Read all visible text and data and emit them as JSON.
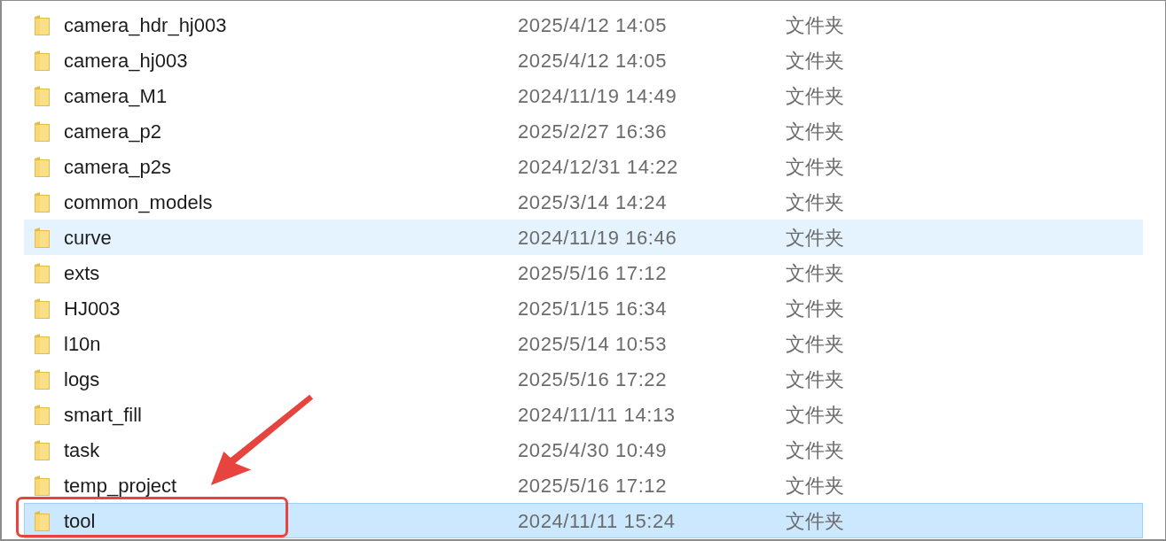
{
  "files": [
    {
      "name": "camera_hdr_hj003",
      "modified": "2025/4/12 14:05",
      "type": "文件夹",
      "selected": false,
      "hovered": false,
      "annotated": false
    },
    {
      "name": "camera_hj003",
      "modified": "2025/4/12 14:05",
      "type": "文件夹",
      "selected": false,
      "hovered": false,
      "annotated": false
    },
    {
      "name": "camera_M1",
      "modified": "2024/11/19 14:49",
      "type": "文件夹",
      "selected": false,
      "hovered": false,
      "annotated": false
    },
    {
      "name": "camera_p2",
      "modified": "2025/2/27 16:36",
      "type": "文件夹",
      "selected": false,
      "hovered": false,
      "annotated": false
    },
    {
      "name": "camera_p2s",
      "modified": "2024/12/31 14:22",
      "type": "文件夹",
      "selected": false,
      "hovered": false,
      "annotated": false
    },
    {
      "name": "common_models",
      "modified": "2025/3/14 14:24",
      "type": "文件夹",
      "selected": false,
      "hovered": false,
      "annotated": false
    },
    {
      "name": "curve",
      "modified": "2024/11/19 16:46",
      "type": "文件夹",
      "selected": false,
      "hovered": true,
      "annotated": false
    },
    {
      "name": "exts",
      "modified": "2025/5/16 17:12",
      "type": "文件夹",
      "selected": false,
      "hovered": false,
      "annotated": false
    },
    {
      "name": "HJ003",
      "modified": "2025/1/15 16:34",
      "type": "文件夹",
      "selected": false,
      "hovered": false,
      "annotated": false
    },
    {
      "name": "l10n",
      "modified": "2025/5/14 10:53",
      "type": "文件夹",
      "selected": false,
      "hovered": false,
      "annotated": false
    },
    {
      "name": "logs",
      "modified": "2025/5/16 17:22",
      "type": "文件夹",
      "selected": false,
      "hovered": false,
      "annotated": false
    },
    {
      "name": "smart_fill",
      "modified": "2024/11/11 14:13",
      "type": "文件夹",
      "selected": false,
      "hovered": false,
      "annotated": false
    },
    {
      "name": "task",
      "modified": "2025/4/30 10:49",
      "type": "文件夹",
      "selected": false,
      "hovered": false,
      "annotated": false
    },
    {
      "name": "temp_project",
      "modified": "2025/5/16 17:12",
      "type": "文件夹",
      "selected": false,
      "hovered": false,
      "annotated": false
    },
    {
      "name": "tool",
      "modified": "2024/11/11 15:24",
      "type": "文件夹",
      "selected": true,
      "hovered": false,
      "annotated": true
    }
  ]
}
